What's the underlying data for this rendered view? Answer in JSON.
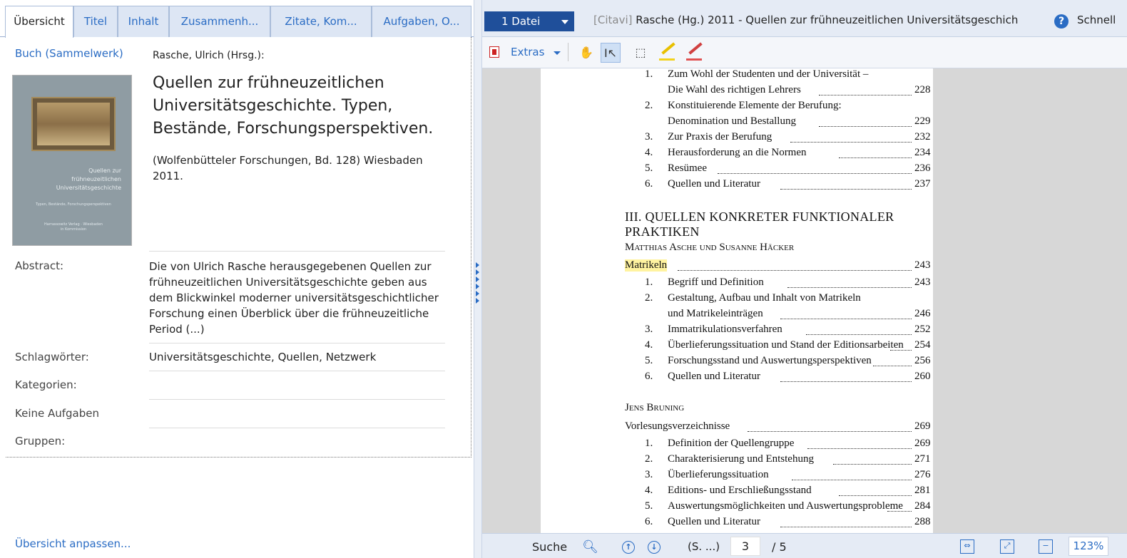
{
  "tabs": [
    "Übersicht",
    "Titel",
    "Inhalt",
    "Zusammenh...",
    "Zitate, Kom...",
    "Aufgaben, O..."
  ],
  "reference": {
    "type": "Buch (Sammelwerk)",
    "author": "Rasche, Ulrich (Hrsg.):",
    "title": "Quellen zur frühneuzeitlichen Universitätsgeschichte. Typen, Bestände, Forschungsperspektiven.",
    "series": "(Wolfenbütteler Forschungen, Bd. 128) Wiesbaden 2011.",
    "cover": {
      "title_lines": [
        "Quellen zur",
        "frühneuzeitlichen",
        "Universitätsgeschichte"
      ],
      "subtitle": "Typen, Bestände, Forschungsperspektiven",
      "publisher_lines": [
        "Harrassowitz Verlag · Wiesbaden",
        "in Kommission"
      ]
    }
  },
  "fields": {
    "abstract_label": "Abstract:",
    "abstract_value": "Die von Ulrich Rasche herausgegebenen Quellen zur frühneuzeitlichen Universitätsgeschichte geben aus dem Blickwinkel moderner universitätsgeschichtlicher Forschung einen Überblick über die frühneuzeitliche Period (...)",
    "keywords_label": "Schlagwörter:",
    "keywords_value": "Universitätsgeschichte, Quellen, Netzwerk",
    "categories_label": "Kategorien:",
    "tasks_label": "Keine Aufgaben",
    "groups_label": "Gruppen:"
  },
  "customize_link": "Übersicht anpassen...",
  "viewer": {
    "file_button": "1 Datei",
    "title_prefix": "[Citavi]",
    "title": "Rasche (Hg.) 2011 - Quellen zur frühneuzeitlichen Universitätsgeschich",
    "quick_help": "Schnell",
    "extras": "Extras",
    "search_label": "Suche",
    "page_label": "(S. ...)",
    "page_current": "3",
    "page_total": "/ 5",
    "zoom": "123%"
  },
  "page_content": {
    "toc_top": [
      {
        "num": "1.",
        "line1": "Zum Wohl der Studenten und der Universität –",
        "line2": "Die Wahl des richtigen Lehrers",
        "page": "228"
      },
      {
        "num": "2.",
        "line1": "Konstituierende Elemente der Berufung:",
        "line2": "Denomination und Bestallung",
        "page": "229"
      },
      {
        "num": "3.",
        "text": "Zur Praxis der Berufung",
        "page": "232"
      },
      {
        "num": "4.",
        "text": "Herausforderung an die Normen",
        "page": "234"
      },
      {
        "num": "5.",
        "text": "Resümee",
        "page": "236"
      },
      {
        "num": "6.",
        "text": "Quellen und Literatur",
        "page": "237"
      }
    ],
    "section_heading": "III. QUELLEN KONKRETER FUNKTIONALER PRAKTIKEN",
    "essay1_authors": "Matthias Asche und Susanne Häcker",
    "essay1_title": "Matrikeln",
    "essay1_page": "243",
    "essay1_toc": [
      {
        "num": "1.",
        "text": "Begriff und Definition",
        "page": "243"
      },
      {
        "num": "2.",
        "line1": "Gestaltung, Aufbau und Inhalt von Matrikeln",
        "line2": "und Matrikeleinträgen",
        "page": "246"
      },
      {
        "num": "3.",
        "text": "Immatrikulationsverfahren",
        "page": "252"
      },
      {
        "num": "4.",
        "text": "Überlieferungssituation und Stand der Editionsarbeiten",
        "page": "254"
      },
      {
        "num": "5.",
        "text": "Forschungsstand und Auswertungsperspektiven",
        "page": "256"
      },
      {
        "num": "6.",
        "text": "Quellen und Literatur",
        "page": "260"
      }
    ],
    "essay2_authors": "Jens Bruning",
    "essay2_title": "Vorlesungsverzeichnisse",
    "essay2_page": "269",
    "essay2_toc": [
      {
        "num": "1.",
        "text": "Definition der Quellengruppe",
        "page": "269"
      },
      {
        "num": "2.",
        "text": "Charakterisierung und Entstehung",
        "page": "271"
      },
      {
        "num": "3.",
        "text": "Überlieferungssituation",
        "page": "276"
      },
      {
        "num": "4.",
        "text": "Editions- und Erschließungsstand",
        "page": "281"
      },
      {
        "num": "5.",
        "text": "Auswertungsmöglichkeiten und Auswertungsprobleme",
        "page": "284"
      },
      {
        "num": "6.",
        "text": "Quellen und Literatur",
        "page": "288"
      }
    ]
  }
}
